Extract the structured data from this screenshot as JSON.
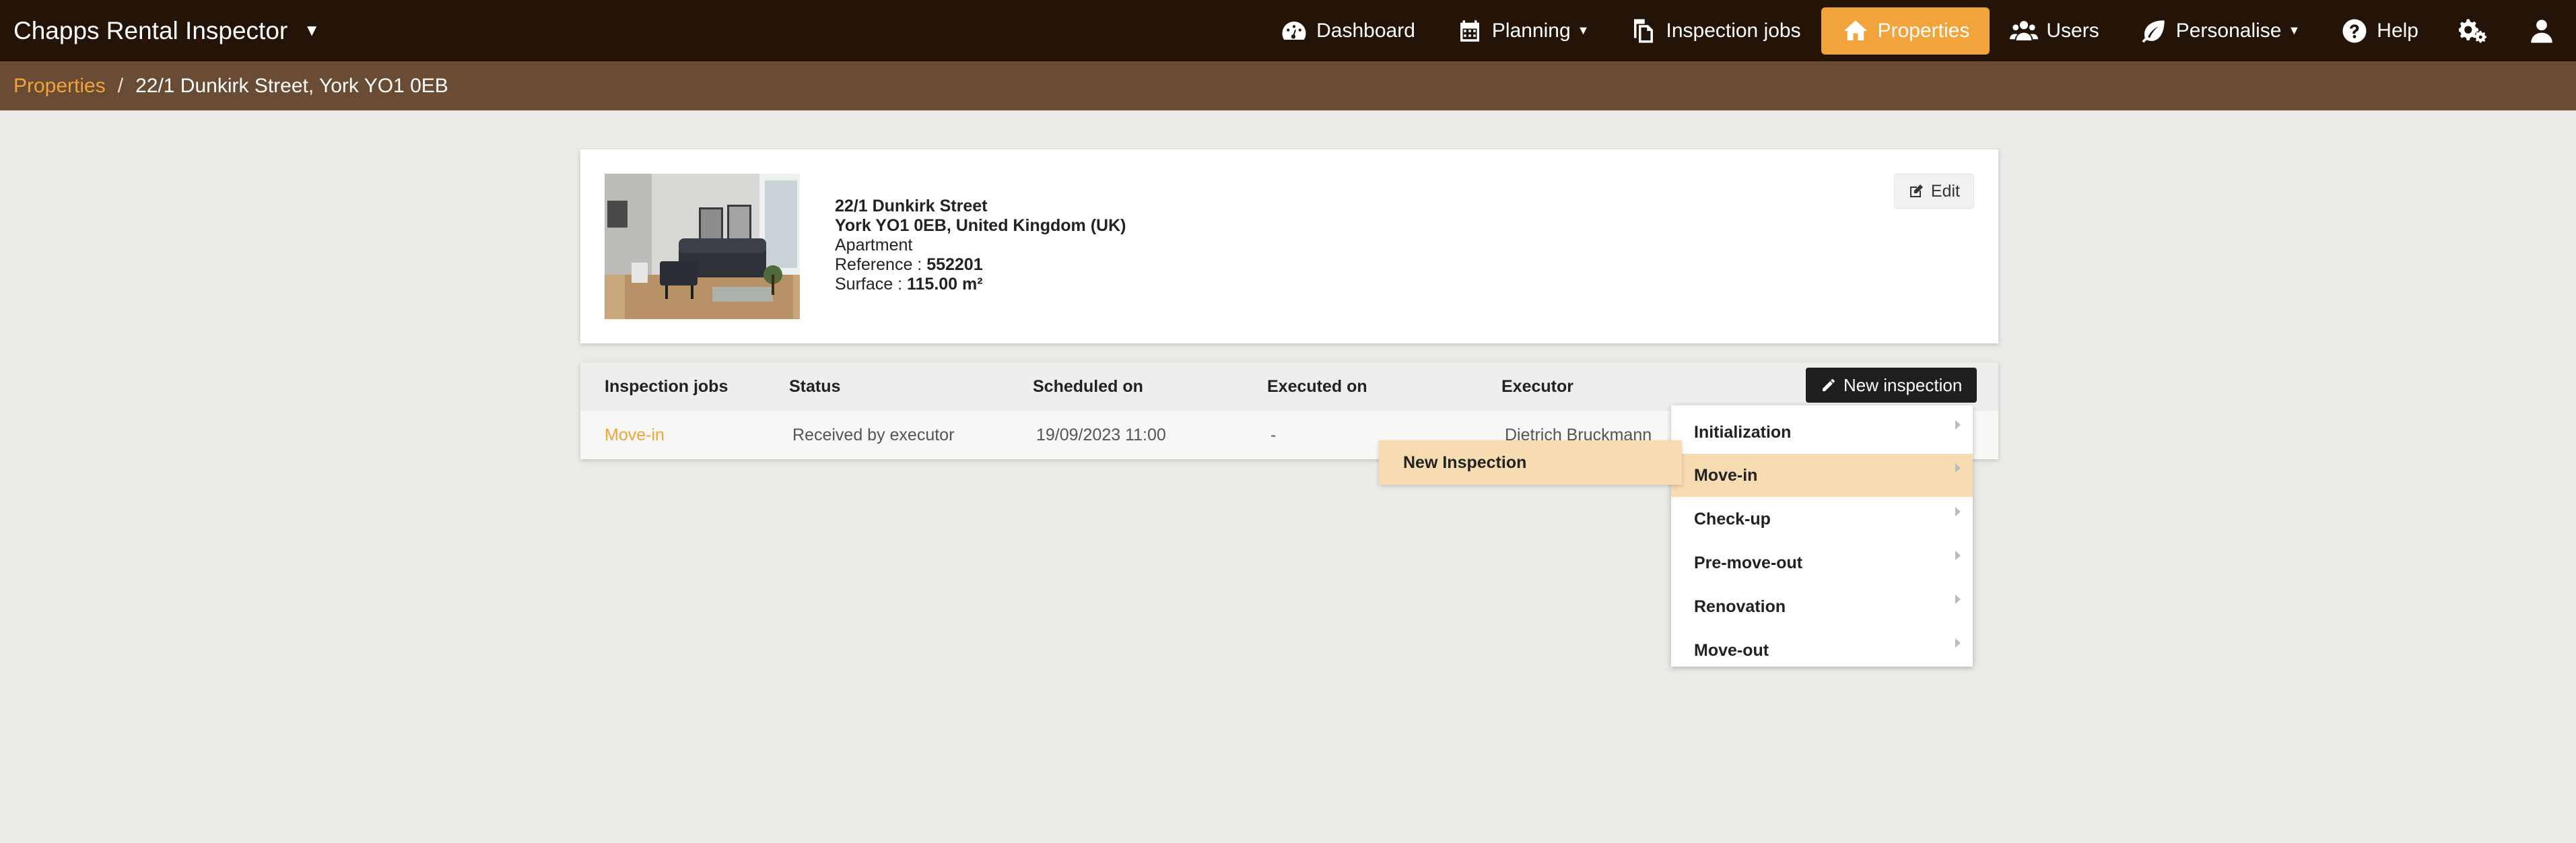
{
  "app": {
    "title": "Chapps Rental Inspector"
  },
  "nav": {
    "dashboard": "Dashboard",
    "planning": "Planning",
    "inspection_jobs": "Inspection jobs",
    "properties": "Properties",
    "users": "Users",
    "personalise": "Personalise",
    "help": "Help",
    "icons": [
      "dashboard-icon",
      "calendar-icon",
      "documents-icon",
      "home-icon",
      "users-icon",
      "leaf-icon",
      "help-icon",
      "gears-icon",
      "user-icon"
    ]
  },
  "breadcrumb": {
    "root": "Properties",
    "separator": "/",
    "current": "22/1 Dunkirk Street, York YO1 0EB"
  },
  "property": {
    "street": "22/1 Dunkirk Street",
    "city_line": "York YO1 0EB, United Kingdom (UK)",
    "type": "Apartment",
    "reference_label": "Reference : ",
    "reference": "552201",
    "surface_label": "Surface : ",
    "surface": "115.00 m²",
    "edit_label": "Edit"
  },
  "jobs_table": {
    "headers": [
      "Inspection jobs",
      "Status",
      "Scheduled on",
      "Executed on",
      "Executor"
    ],
    "new_button": "New inspection",
    "rows": [
      {
        "job": "Move-in",
        "status": "Received by executor",
        "scheduled": "19/09/2023 11:00",
        "executed": "-",
        "executor": "Dietrich Bruckmann"
      }
    ]
  },
  "menu": {
    "items": [
      "Initialization",
      "Move-in",
      "Check-up",
      "Pre-move-out",
      "Renovation",
      "Move-out"
    ],
    "active": "Move-in",
    "submenu_item": "New Inspection"
  },
  "colors": {
    "navbar": "#241408",
    "breadcrumb_bar": "#6a4b33",
    "accent": "#f2a33a",
    "menu_highlight": "#f6dcb0"
  }
}
